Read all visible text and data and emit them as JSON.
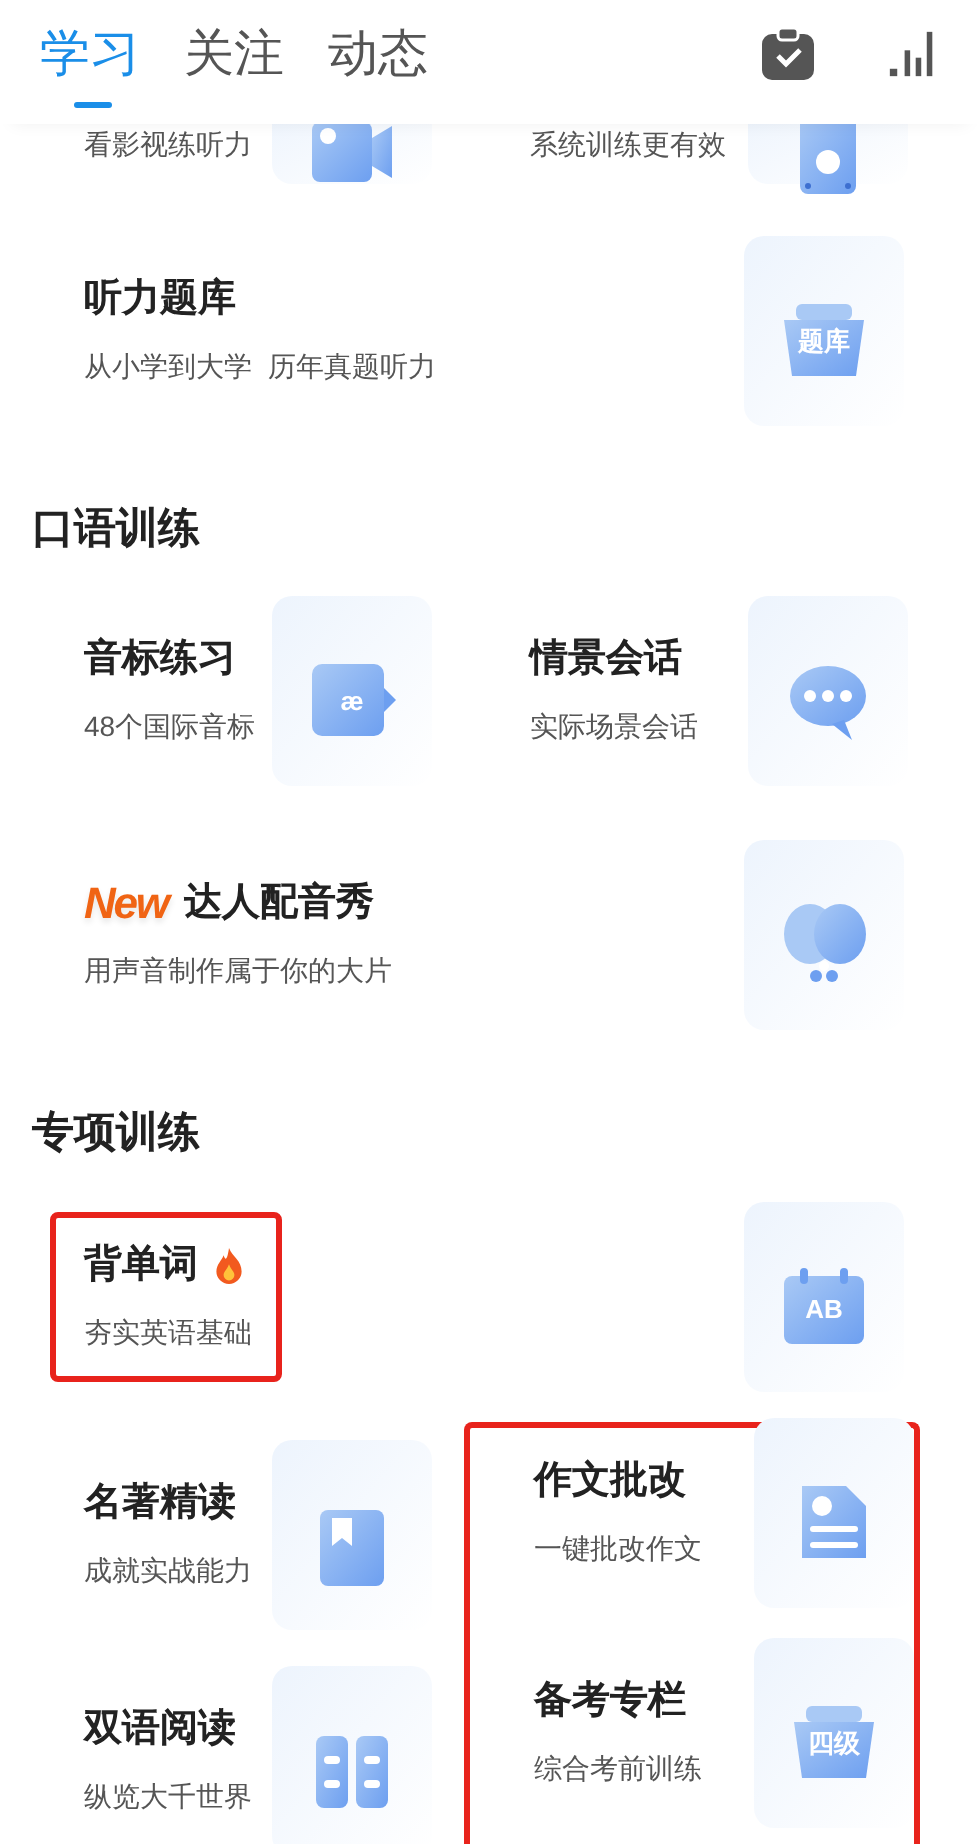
{
  "tabs": [
    {
      "label": "学习",
      "selected": true
    },
    {
      "label": "关注",
      "selected": false
    },
    {
      "label": "动态",
      "selected": false
    }
  ],
  "sections": [
    {
      "rows": [
        {
          "items": [
            {
              "subtitle": "看影视练听力",
              "highlighted": false
            },
            {
              "subtitle": "系统训练更有效",
              "highlighted": false
            }
          ]
        },
        {
          "items": [
            {
              "title": "听力题库",
              "subtitle": "从小学到大学  历年真题听力",
              "icon_text": "题库",
              "highlighted": false
            }
          ]
        }
      ]
    },
    {
      "title": "口语训练",
      "rows": [
        {
          "items": [
            {
              "title": "音标练习",
              "subtitle": "48个国际音标",
              "icon_text": "æ",
              "highlighted": false
            },
            {
              "title": "情景会话",
              "subtitle": "实际场景会话",
              "highlighted": false
            }
          ]
        },
        {
          "items": [
            {
              "title": "达人配音秀",
              "badge": "New",
              "subtitle": "用声音制作属于你的大片",
              "highlighted": false
            }
          ]
        }
      ]
    },
    {
      "title": "专项训练",
      "rows": [
        {
          "items": [
            {
              "title": "背单词",
              "hot": true,
              "subtitle": "夯实英语基础",
              "icon_text": "AB",
              "highlighted": true
            }
          ]
        },
        {
          "items": [
            {
              "title": "名著精读",
              "subtitle": "成就实战能力",
              "highlighted": false
            },
            {
              "title": "作文批改",
              "subtitle": "一键批改作文",
              "highlighted": true
            }
          ]
        },
        {
          "items": [
            {
              "title": "双语阅读",
              "subtitle": "纵览大千世界",
              "highlighted": false
            },
            {
              "title": "备考专栏",
              "subtitle": "综合考前训练",
              "icon_text": "四级",
              "highlighted": true
            }
          ]
        }
      ]
    }
  ]
}
